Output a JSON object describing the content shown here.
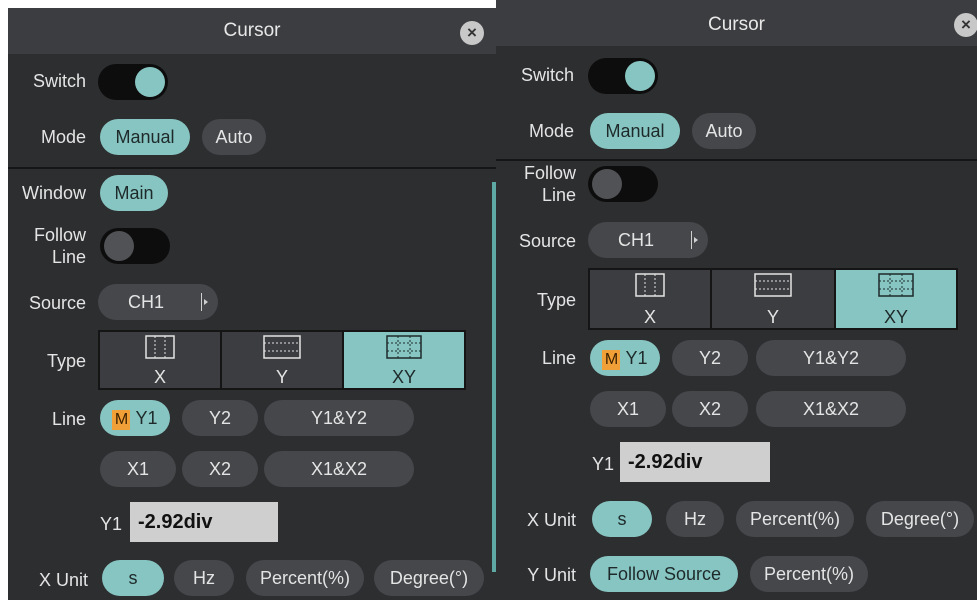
{
  "panel_left": {
    "title": "Cursor",
    "close_symbol": "×",
    "switch": {
      "label": "Switch",
      "state": "on"
    },
    "mode": {
      "label": "Mode",
      "options": [
        "Manual",
        "Auto"
      ],
      "selected": "Manual"
    },
    "window": {
      "label": "Window",
      "value": "Main"
    },
    "follow_line": {
      "label_line1": "Follow",
      "label_line2": "Line",
      "state": "off"
    },
    "source": {
      "label": "Source",
      "value": "CH1"
    },
    "type": {
      "label": "Type",
      "options": [
        "X",
        "Y",
        "XY"
      ],
      "selected": "XY"
    },
    "line": {
      "label": "Line",
      "badge": "M",
      "options": [
        "Y1",
        "Y2",
        "Y1&Y2",
        "X1",
        "X2",
        "X1&X2"
      ],
      "selected": "Y1"
    },
    "y1": {
      "label": "Y1",
      "value": "-2.92div"
    },
    "x_unit": {
      "label": "X Unit",
      "options": [
        "s",
        "Hz",
        "Percent(%)",
        "Degree(°)"
      ],
      "selected": "s"
    }
  },
  "panel_right": {
    "title": "Cursor",
    "close_symbol": "×",
    "switch": {
      "label": "Switch",
      "state": "on"
    },
    "mode": {
      "label": "Mode",
      "options": [
        "Manual",
        "Auto"
      ],
      "selected": "Manual"
    },
    "follow_line": {
      "label_line1": "Follow",
      "label_line2": "Line",
      "state": "off"
    },
    "source": {
      "label": "Source",
      "value": "CH1"
    },
    "type": {
      "label": "Type",
      "options": [
        "X",
        "Y",
        "XY"
      ],
      "selected": "XY"
    },
    "line": {
      "label": "Line",
      "badge": "M",
      "options": [
        "Y1",
        "Y2",
        "Y1&Y2",
        "X1",
        "X2",
        "X1&X2"
      ],
      "selected": "Y1"
    },
    "y1": {
      "label": "Y1",
      "value": "-2.92div"
    },
    "x_unit": {
      "label": "X Unit",
      "options": [
        "s",
        "Hz",
        "Percent(%)",
        "Degree(°)"
      ],
      "selected": "s"
    },
    "y_unit": {
      "label": "Y Unit",
      "options": [
        "Follow Source",
        "Percent(%)"
      ],
      "selected": "Follow Source"
    }
  },
  "colors": {
    "panel_bg": "#2d2e30",
    "title_bg": "#3c3d40",
    "accent": "#87c5c2",
    "button_bg": "#45474b",
    "badge": "#f0a036"
  },
  "icons": [
    "close-icon",
    "dropdown-caret-icon",
    "cursor-x-icon",
    "cursor-y-icon",
    "cursor-xy-icon"
  ]
}
